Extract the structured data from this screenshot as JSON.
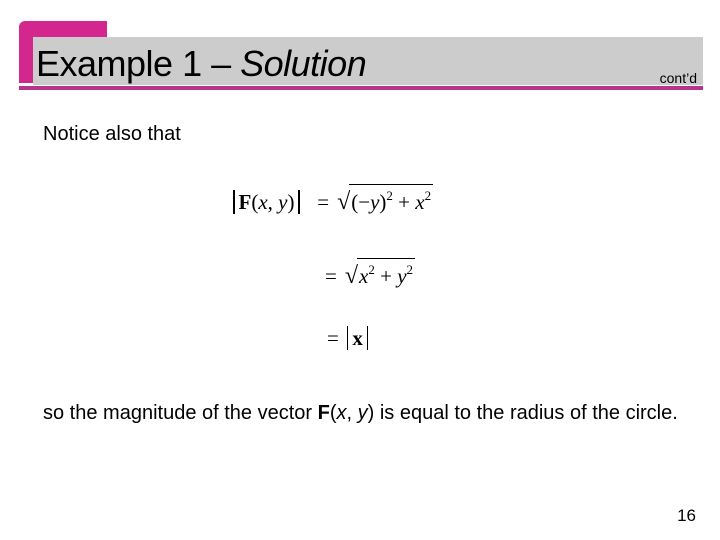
{
  "header": {
    "title_main": "Example 1 – ",
    "title_italic": "Solution",
    "continued": "cont’d",
    "colors": {
      "accent_box": "#d4268f",
      "bar": "#cccccc",
      "underline": "#b8348a"
    }
  },
  "body": {
    "intro": "Notice also that",
    "equations": {
      "line1": {
        "lhs_bold": "F",
        "lhs_args_open": "(",
        "lhs_x": "x",
        "lhs_comma": ", ",
        "lhs_y": "y",
        "lhs_args_close": ")",
        "eq": "=",
        "sqrt": "√",
        "r1": "(−",
        "r1_y": "y",
        "r1_close": ")",
        "r1_exp": "2",
        "plus": "+",
        "r2_x": "x",
        "r2_exp": "2"
      },
      "line2": {
        "eq": "=",
        "sqrt": "√",
        "a": "x",
        "a_exp": "2",
        "plus": "+",
        "b": "y",
        "b_exp": "2"
      },
      "line3": {
        "eq": "=",
        "vec": "x"
      }
    },
    "conclusion": {
      "pre": "so the magnitude of the vector ",
      "bold": "F",
      "open": "(",
      "x": "x",
      "comma": ", ",
      "y": "y",
      "close": ")",
      "post": " is equal to the radius of the circle."
    }
  },
  "footer": {
    "page_number": "16"
  }
}
